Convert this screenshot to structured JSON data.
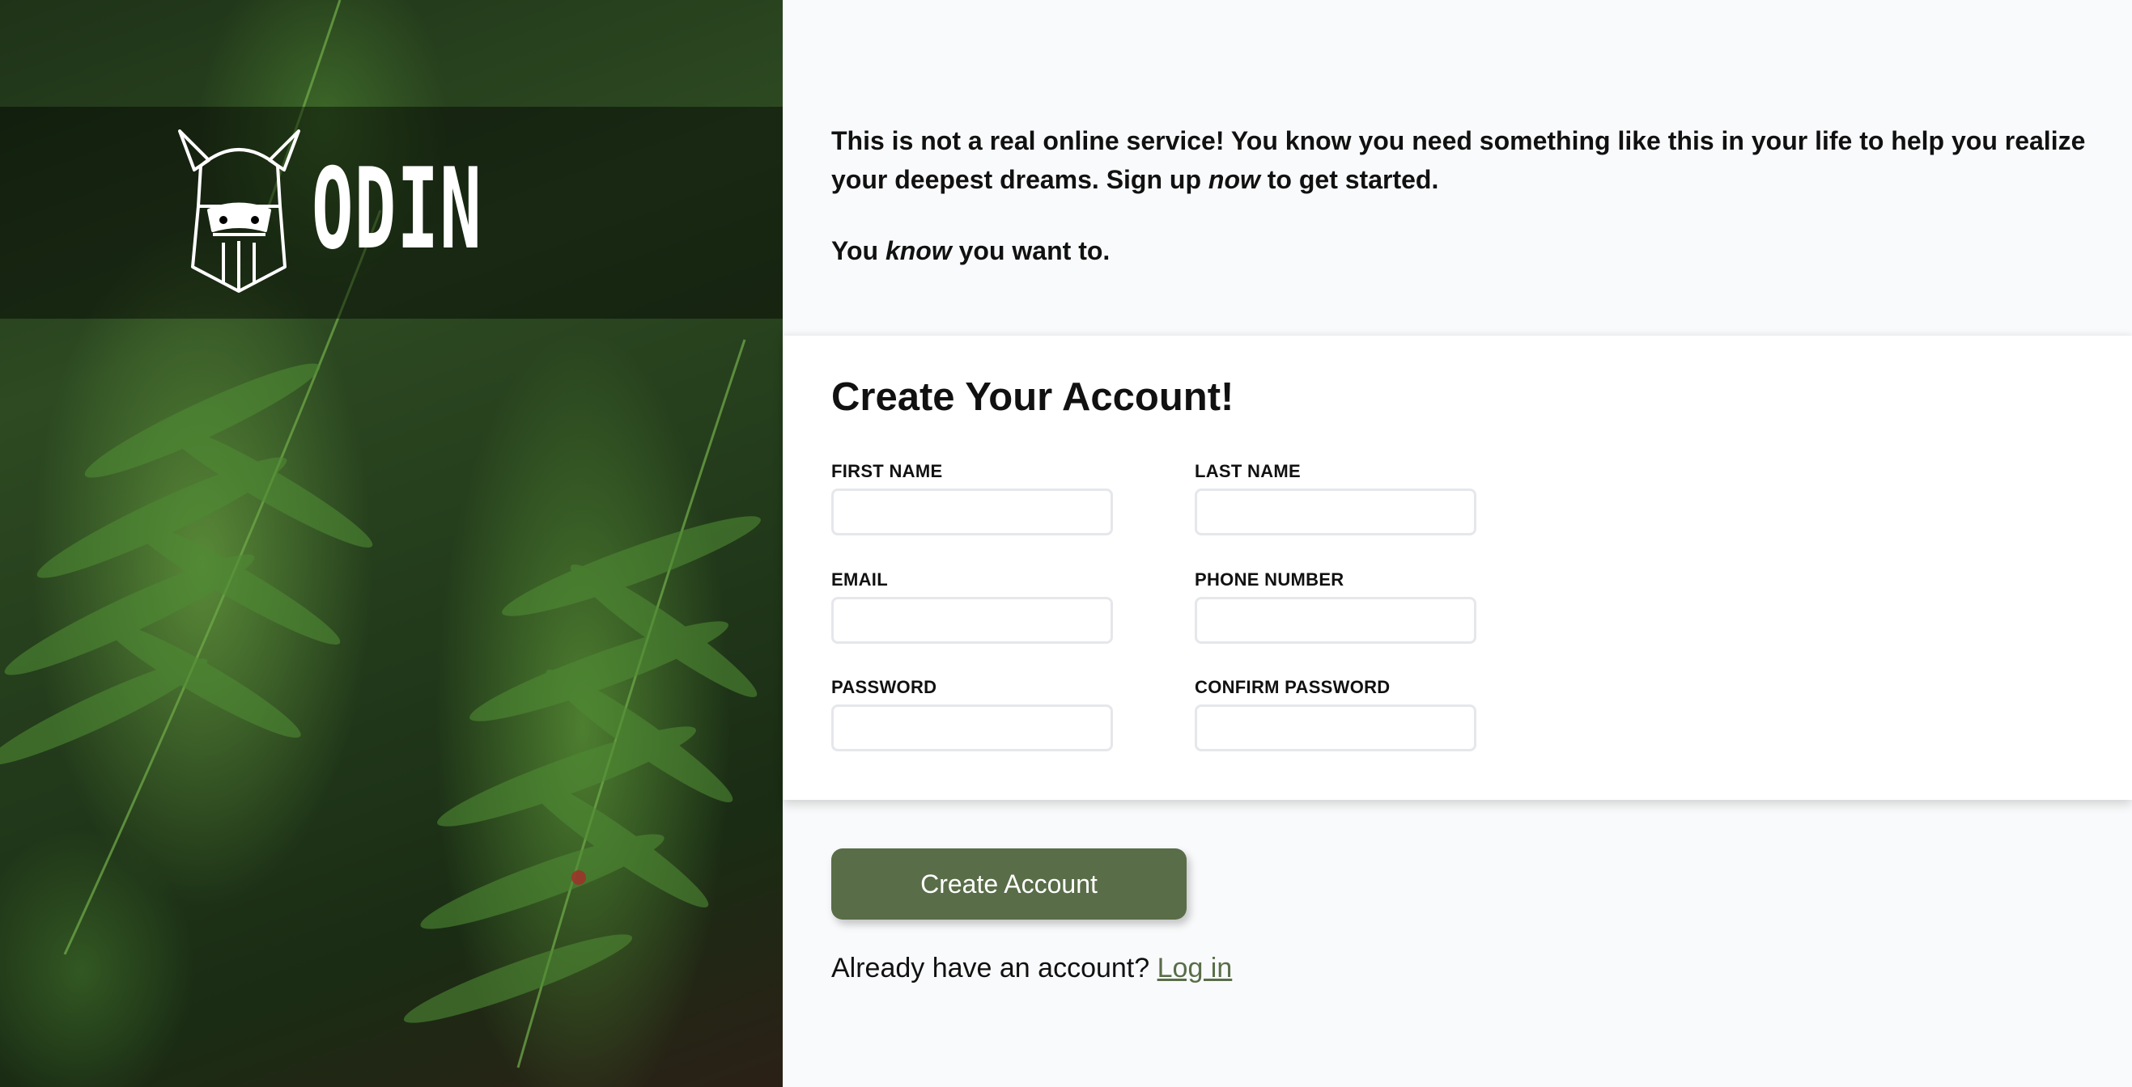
{
  "brand": {
    "name": "ODIN",
    "logo_icon": "viking-helmet-icon"
  },
  "intro": {
    "line1_a": "This is not a real online service! You know you need something like this in your life to help you realize your deepest dreams. Sign up",
    "line1_em": "now",
    "line1_b": "to get started.",
    "line2_a": "You",
    "line2_em": "know",
    "line2_b": "you want to."
  },
  "form": {
    "title": "Create Your Account!",
    "fields": [
      {
        "label": "FIRST NAME",
        "value": ""
      },
      {
        "label": "LAST NAME",
        "value": ""
      },
      {
        "label": "EMAIL",
        "value": ""
      },
      {
        "label": "PHONE NUMBER",
        "value": ""
      },
      {
        "label": "PASSWORD",
        "value": ""
      },
      {
        "label": "CONFIRM PASSWORD",
        "value": ""
      }
    ]
  },
  "submit_label": "Create Account",
  "login": {
    "prompt": "Already have an account?",
    "link_label": "Log in"
  },
  "colors": {
    "accent": "#596d48",
    "page_bg": "#f9fafb",
    "card_bg": "#ffffff"
  }
}
